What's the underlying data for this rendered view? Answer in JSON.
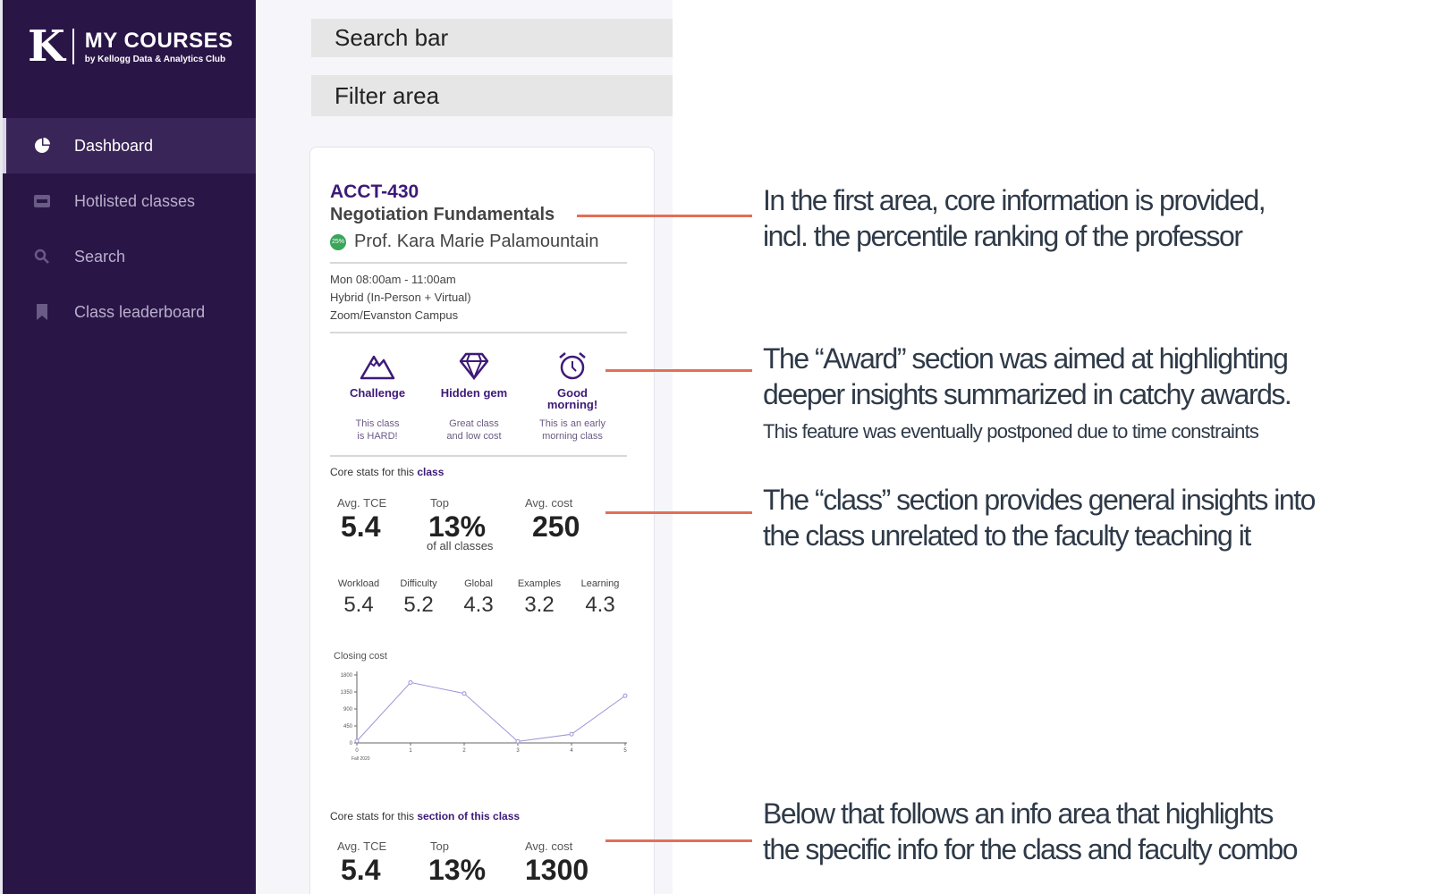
{
  "sidebar": {
    "logo_letter": "K",
    "logo_title": "MY COURSES",
    "logo_subtitle": "by Kellogg Data & Analytics Club",
    "items": [
      {
        "label": "Dashboard",
        "icon": "pie-chart-icon",
        "active": true
      },
      {
        "label": "Hotlisted classes",
        "icon": "ticket-icon",
        "active": false
      },
      {
        "label": "Search",
        "icon": "search-icon",
        "active": false
      },
      {
        "label": "Class leaderboard",
        "icon": "bookmark-icon",
        "active": false
      }
    ]
  },
  "placeholders": {
    "search_bar": "Search bar",
    "filter_area": "Filter area"
  },
  "course": {
    "code": "ACCT-430",
    "name": "Negotiation Fundamentals",
    "professor_badge": "25%",
    "professor": "Prof. Kara Marie Palamountain",
    "schedule": [
      "Mon 08:00am - 11:00am",
      "Hybrid (In-Person + Virtual)",
      "Zoom/Evanston Campus"
    ],
    "awards": [
      {
        "icon": "mountain-icon",
        "title_lines": [
          "Challenge"
        ],
        "desc_lines": [
          "This class",
          "is HARD!"
        ]
      },
      {
        "icon": "diamond-icon",
        "title_lines": [
          "Hidden gem"
        ],
        "desc_lines": [
          "Great class",
          "and low cost"
        ]
      },
      {
        "icon": "alarm-clock-icon",
        "title_lines": [
          "Good",
          "morning!"
        ],
        "desc_lines": [
          "This is an early",
          "morning class"
        ]
      }
    ],
    "class_stats": {
      "label_prefix": "Core stats for this ",
      "label_emph": "class",
      "avg_tce_label": "Avg. TCE",
      "avg_tce": "5.4",
      "top_label": "Top",
      "top": "13%",
      "top_sub": "of all classes",
      "avg_cost_label": "Avg. cost",
      "avg_cost": "250",
      "metrics": [
        {
          "label": "Workload",
          "value": "5.4"
        },
        {
          "label": "Difficulty",
          "value": "5.2"
        },
        {
          "label": "Global",
          "value": "4.3"
        },
        {
          "label": "Examples",
          "value": "3.2"
        },
        {
          "label": "Learning",
          "value": "4.3"
        }
      ]
    },
    "section_stats": {
      "label_prefix": "Core stats for this ",
      "label_emph": "section of this class",
      "avg_tce_label": "Avg. TCE",
      "avg_tce": "5.4",
      "top_label": "Top",
      "top": "13%",
      "avg_cost_label": "Avg. cost",
      "avg_cost": "1300"
    }
  },
  "chart_data": {
    "type": "line",
    "title": "Closing cost",
    "x": [
      0,
      1,
      2,
      3,
      4,
      5
    ],
    "x_tick_labels": [
      "0",
      "1",
      "2",
      "3",
      "4",
      "5"
    ],
    "x_first_sublabel": "Fall 2020",
    "y_ticks": [
      0,
      450,
      900,
      1350,
      1800
    ],
    "ylim": [
      0,
      1800
    ],
    "series": [
      {
        "values": [
          50,
          1600,
          1310,
          40,
          230,
          1250
        ]
      }
    ],
    "line_color": "#9b95d6"
  },
  "annotations": [
    {
      "lines": [
        "In the first area, core information is provided,",
        "incl. the percentile ranking of the professor"
      ]
    },
    {
      "lines": [
        "The “Award” section was aimed at highlighting",
        "deeper insights summarized in catchy awards."
      ],
      "small": "This feature was eventually postponed due to time constraints"
    },
    {
      "lines": [
        "The “class” section provides general insights into",
        "the class unrelated to the faculty teaching it"
      ]
    },
    {
      "lines": [
        "Below that follows an info area that highlights",
        "the specific info for the class and faculty combo"
      ]
    }
  ],
  "colors": {
    "sidebar_bg": "#2a1547",
    "accent": "#3d1a78",
    "annotation_line": "#e26f56",
    "annotation_text": "#2f3a48"
  }
}
